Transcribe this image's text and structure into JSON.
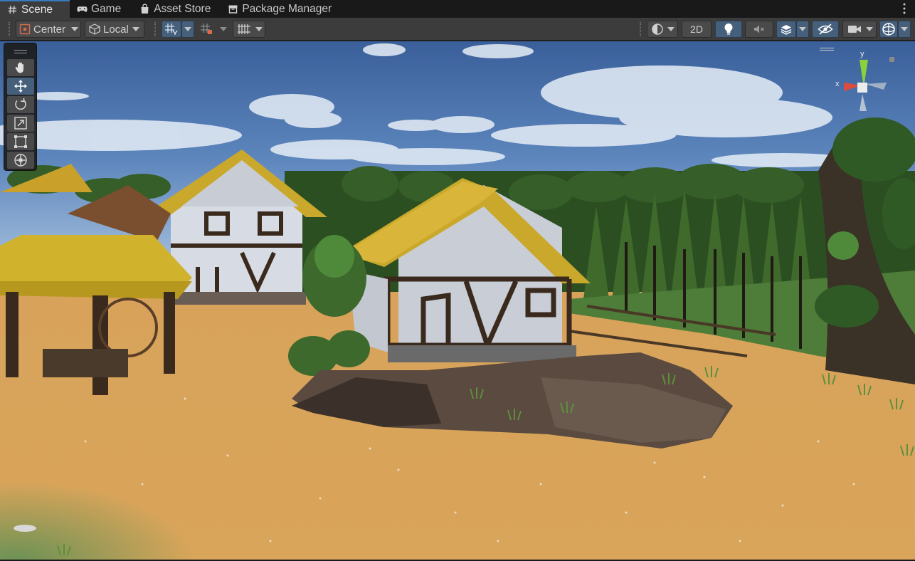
{
  "tabs": [
    {
      "label": "Scene",
      "icon": "hash-icon",
      "active": true
    },
    {
      "label": "Game",
      "icon": "gamepad-icon",
      "active": false
    },
    {
      "label": "Asset Store",
      "icon": "shopping-bag-icon",
      "active": false
    },
    {
      "label": "Package Manager",
      "icon": "package-icon",
      "active": false
    }
  ],
  "toolbar": {
    "pivot_mode": "Center",
    "pivot_rotation": "Local",
    "mode_2d": "2D"
  },
  "gizmo": {
    "y_label": "y",
    "x_label": "x"
  },
  "colors": {
    "accent": "#3a79bb",
    "active_toggle": "#46607c",
    "toolbar_bg": "#3c3c3c",
    "tab_bg": "#191919"
  }
}
